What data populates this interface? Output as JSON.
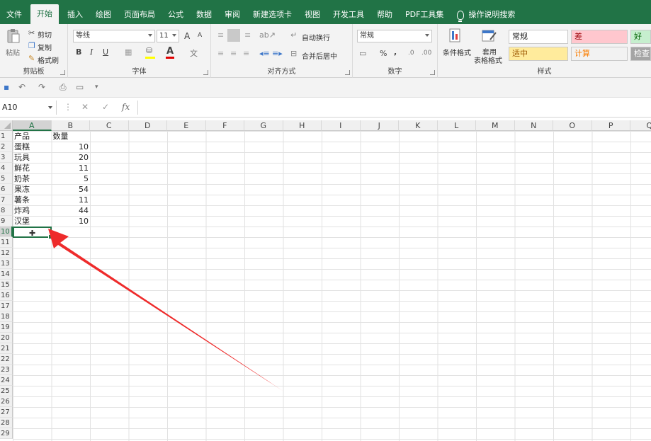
{
  "ribbon_tabs": [
    "文件",
    "开始",
    "插入",
    "绘图",
    "页面布局",
    "公式",
    "数据",
    "审阅",
    "新建选项卡",
    "视图",
    "开发工具",
    "帮助",
    "PDF工具集"
  ],
  "active_tab": "开始",
  "tell_me": "操作说明搜索",
  "clipboard": {
    "paste": "粘贴",
    "cut": "剪切",
    "copy": "复制",
    "format_painter": "格式刷",
    "label": "剪贴板"
  },
  "font": {
    "name": "等线",
    "size": "11",
    "grow": "A",
    "shrink": "A",
    "bold": "B",
    "italic": "I",
    "underline": "U",
    "color_letter": "A",
    "label": "字体"
  },
  "alignment": {
    "wrap": "自动换行",
    "merge": "合并后居中",
    "label": "对齐方式"
  },
  "number": {
    "format": "常规",
    "percent": "%",
    "comma": ",",
    "label": "数字"
  },
  "styles": {
    "conditional": "条件格式",
    "table_format_line1": "套用",
    "table_format_line2": "表格格式",
    "label": "样式",
    "cells": [
      {
        "text": "常规",
        "bg": "#ffffff",
        "fg": "#222222"
      },
      {
        "text": "差",
        "bg": "#ffc7ce",
        "fg": "#9c0006"
      },
      {
        "text": "好",
        "bg": "#c6efce",
        "fg": "#006100"
      },
      {
        "text": "适中",
        "bg": "#ffeb9c",
        "fg": "#9c5700"
      },
      {
        "text": "计算",
        "bg": "#f2f2f2",
        "fg": "#fa7d00"
      },
      {
        "text": "检查",
        "bg": "#a5a5a5",
        "fg": "#ffffff"
      }
    ]
  },
  "name_box": "A10",
  "fb_cancel": "✕",
  "fb_enter": "✓",
  "fb_fx": "fx",
  "columns": [
    "A",
    "B",
    "C",
    "D",
    "E",
    "F",
    "G",
    "H",
    "I",
    "J",
    "K",
    "L",
    "M",
    "N",
    "O",
    "P",
    "Q"
  ],
  "rows": [
    "1",
    "2",
    "3",
    "4",
    "5",
    "6",
    "7",
    "8",
    "9",
    "10",
    "11",
    "12",
    "13",
    "14",
    "15",
    "16",
    "17",
    "18",
    "19",
    "20",
    "21",
    "22",
    "23",
    "24",
    "25",
    "26",
    "27",
    "28",
    "29"
  ],
  "table": {
    "headers": [
      "产品",
      "数量"
    ],
    "rows": [
      [
        "蛋糕",
        "10"
      ],
      [
        "玩具",
        "20"
      ],
      [
        "鲜花",
        "11"
      ],
      [
        "奶茶",
        "5"
      ],
      [
        "果冻",
        "54"
      ],
      [
        "薯条",
        "11"
      ],
      [
        "炸鸡",
        "44"
      ],
      [
        "汉堡",
        "10"
      ]
    ]
  },
  "selected_cell": "A10",
  "accent": "#217346",
  "arrow_color": "#ee2b2b"
}
